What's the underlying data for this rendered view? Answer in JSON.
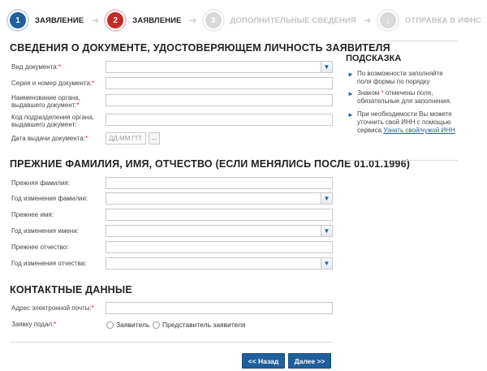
{
  "stepper": [
    {
      "num": "1",
      "label": "Заявление",
      "state": "done"
    },
    {
      "num": "2",
      "label": "Заявление",
      "state": "active"
    },
    {
      "num": "3",
      "label": "Дополнительные сведения",
      "state": "todo"
    },
    {
      "num": "↓",
      "label": "Отправка в ИФНС",
      "state": "todo"
    }
  ],
  "section1": {
    "title": "Сведения о документе, удостоверяющем личность заявителя",
    "doc_type_label": "Вид документа:",
    "series_label": "Серия и номер документа:",
    "issuer_label": "Наименование органа, выдавшего документ:",
    "issuer_code_label": "Код подразделения органа, выдавшего документ:",
    "issue_date_label": "Дата выдачи документа:",
    "issue_date_placeholder": "ДД.ММ.ГГГ",
    "date_picker_label": "..."
  },
  "section2": {
    "title": "Прежние фамилия, имя, отчество (если менялись после 01.01.1996)",
    "prev_surname_label": "Прежняя фамилия:",
    "surname_year_label": "Год изменения фамилии:",
    "prev_name_label": "Прежнее имя:",
    "name_year_label": "Год изменения имени:",
    "prev_patronymic_label": "Прежнее отчество:",
    "patronymic_year_label": "Год изменения отчества:"
  },
  "section3": {
    "title": "Контактные данные",
    "email_label": "Адрес электронной почты:",
    "submitted_by_label": "Заявку подал:",
    "radio_applicant": "Заявитель",
    "radio_representative": "Представитель заявителя"
  },
  "required_mark": "*",
  "buttons": {
    "back": "<< Назад",
    "next": "Далее >>"
  },
  "hint": {
    "title": "Подсказка",
    "item1": "По возможности заполняйте поля формы по порядку",
    "item2_pre": "Знаком",
    "item2_post": "отмечены поля, обязательные для заполнения.",
    "item3_pre": "При необходимости Вы можете уточнить свой ИНН с помощью сервиса",
    "item3_link": "Узнать свой/чужой ИНН"
  },
  "colors": {
    "accent_blue": "#1f5f9c",
    "active_red": "#c42a2a",
    "inactive_grey": "#d9d9d9"
  }
}
